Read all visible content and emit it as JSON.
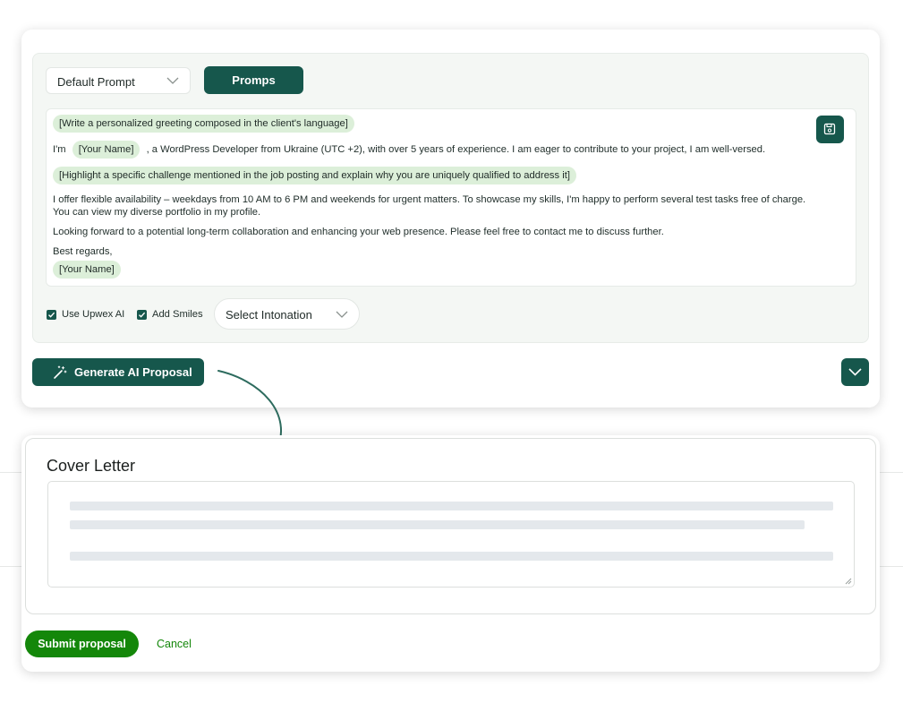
{
  "prompt_panel": {
    "prompt_select_value": "Default Prompt",
    "promps_button": "Promps",
    "editor": {
      "line1_chip": "[Write a personalized greeting composed in the client's language]",
      "line2_prefix": "I'm",
      "line2_chip": "[Your Name]",
      "line2_suffix": ", a WordPress Developer from Ukraine (UTC +2), with over 5 years of experience. I am eager to contribute to your project, I am well-versed.",
      "line3_chip": "[Highlight a specific challenge mentioned in the job posting and explain why you are uniquely qualified to address it]",
      "para1_line1": "I offer flexible availability – weekdays from 10 AM to 6 PM and weekends for urgent matters. To showcase my skills, I'm happy to perform several test tasks free of charge.",
      "para1_line2": "You can view my diverse portfolio in my profile.",
      "para2": "Looking forward to a potential long-term collaboration and enhancing your web presence. Please feel free to contact me to discuss further.",
      "closing": "Best regards,",
      "signature_chip": "[Your Name]"
    },
    "use_upwex_ai_label": "Use Upwex AI",
    "add_smiles_label": "Add Smiles",
    "intonation_select_value": "Select Intonation",
    "generate_button": "Generate AI Proposal"
  },
  "cover_letter": {
    "title": "Cover Letter"
  },
  "actions": {
    "submit_button": "Submit proposal",
    "cancel_link": "Cancel"
  },
  "colors": {
    "primary_dark_green": "#16574c",
    "chip_green": "#dcefd9",
    "submit_green": "#14870a"
  }
}
